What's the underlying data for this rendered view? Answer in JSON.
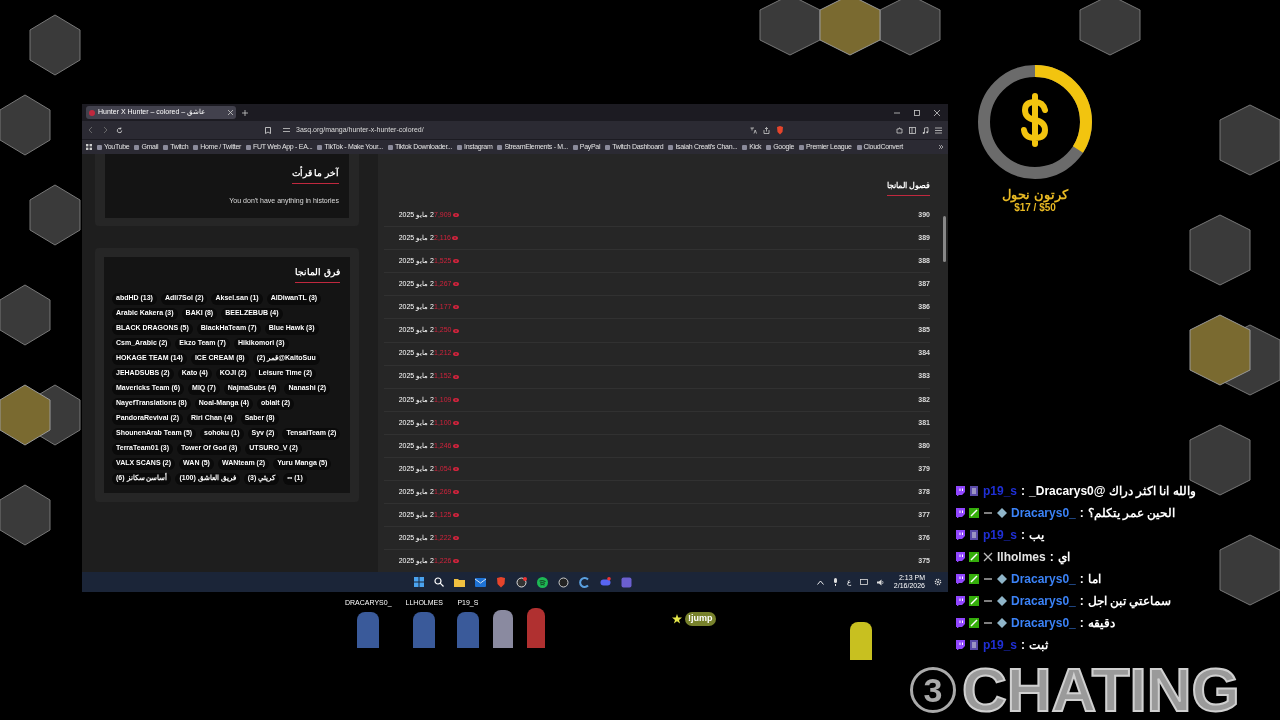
{
  "browser": {
    "tab_title": "Hunter X Hunter – colored – عاشق",
    "url": "3asq.org/manga/hunter-x-hunter-colored/",
    "bookmarks": [
      "YouTube",
      "Gmail",
      "Twitch",
      "Home / Twitter",
      "FUT Web App - EA...",
      "TikTok - Make Your...",
      "Tiktok Downloader...",
      "Instagram",
      "StreamElements - M...",
      "PayPal",
      "Twitch Dashboard",
      "Isaiah Creati's Chan...",
      "Kick",
      "Google",
      "Premier League",
      "CloudConvert"
    ]
  },
  "history_card": {
    "title": "آخر ما قرأت",
    "message": "You don't have anything in histories"
  },
  "teams_card": {
    "title": "فرق المانجا",
    "tags": [
      "abdHD (13)",
      "Adli7Sol (2)",
      "Aksel.san (1)",
      "AlDiwanTL (3)",
      "Arabic Kakera (3)",
      "BAKI (8)",
      "BEELZEBUB (4)",
      "BLACK DRAGONS (5)",
      "BlackHaTeam (7)",
      "Blue Hawk (3)",
      "Csm_Arabic (2)",
      "Ekzo Team (7)",
      "Hikikomori (3)",
      "HOKAGE TEAM (14)",
      "ICE CREAM (8)",
      "(2) قمر@KaitoSuu",
      "JEHADSUBS (2)",
      "Kato (4)",
      "KOJI (2)",
      "Leisure Time (2)",
      "Mavericks Team (6)",
      "MIQ (7)",
      "NajmaSubs (4)",
      "Nanashi (2)",
      "NayefTranslations (8)",
      "Noal-Manga (4)",
      "oblalt (2)",
      "PandoraRevival (2)",
      "Riri Chan (4)",
      "Saber (8)",
      "ShounenArab Team (5)",
      "sohoku (1)",
      "Syv (2)",
      "TensaiTeam (2)",
      "TerraTeam01 (3)",
      "Tower Of God (3)",
      "UTSURO_V (2)",
      "VALX SCANS (2)",
      "WAN (5)",
      "WANteam (2)",
      "Yuru Manga (5)",
      "أساسن سكانز (6)",
      "فريق العاشق (100)",
      "كريثي (3)",
      "∞ (1)"
    ]
  },
  "chapters": {
    "title": "فصول المانجا",
    "rows": [
      {
        "number": "390",
        "views": "7,909",
        "date": "2 مايو 2025"
      },
      {
        "number": "389",
        "views": "2,116",
        "date": "2 مايو 2025"
      },
      {
        "number": "388",
        "views": "1,525",
        "date": "2 مايو 2025"
      },
      {
        "number": "387",
        "views": "1,267",
        "date": "2 مايو 2025"
      },
      {
        "number": "386",
        "views": "1,177",
        "date": "2 مايو 2025"
      },
      {
        "number": "385",
        "views": "1,250",
        "date": "2 مايو 2025"
      },
      {
        "number": "384",
        "views": "1,212",
        "date": "2 مايو 2025"
      },
      {
        "number": "383",
        "views": "1,152",
        "date": "2 مايو 2025"
      },
      {
        "number": "382",
        "views": "1,109",
        "date": "2 مايو 2025"
      },
      {
        "number": "381",
        "views": "1,100",
        "date": "2 مايو 2025"
      },
      {
        "number": "380",
        "views": "1,246",
        "date": "2 مايو 2025"
      },
      {
        "number": "379",
        "views": "1,054",
        "date": "2 مايو 2025"
      },
      {
        "number": "378",
        "views": "1,269",
        "date": "2 مايو 2025"
      },
      {
        "number": "377",
        "views": "1,125",
        "date": "2 مايو 2025"
      },
      {
        "number": "376",
        "views": "1,222",
        "date": "2 مايو 2025"
      },
      {
        "number": "375",
        "views": "1,226",
        "date": "2 مايو 2025"
      }
    ]
  },
  "taskbar": {
    "language": "ع",
    "time": "2:13 PM",
    "date": "2/16/2026"
  },
  "goal": {
    "title": "كرتون نحول",
    "amount": "$17 / $50",
    "level": 0.34
  },
  "chat": [
    {
      "kind": "subscriber",
      "user": "p19_s",
      "color": "#1f2fd6",
      "separator": ":",
      "message": "والله انا اكثر دراك @Dracarys0_"
    },
    {
      "kind": "gem",
      "user": "Dracarys0_",
      "color": "#3b82f6",
      "separator": ":",
      "message": "الحين عمر يتكلم؟"
    },
    {
      "kind": "subscriber",
      "user": "p19_s",
      "color": "#1f2fd6",
      "separator": ":",
      "message": "يب"
    },
    {
      "kind": "blade",
      "user": "llholmes",
      "color": "#e5e5e5",
      "separator": ":",
      "message": "اي"
    },
    {
      "kind": "gem",
      "user": "Dracarys0_",
      "color": "#3b82f6",
      "separator": ":",
      "message": "اما"
    },
    {
      "kind": "gem",
      "user": "Dracarys0_",
      "color": "#3b82f6",
      "separator": ":",
      "message": "سماعتي تبن اجل"
    },
    {
      "kind": "gem",
      "user": "Dracarys0_",
      "color": "#3b82f6",
      "separator": ":",
      "message": "دقيقه"
    },
    {
      "kind": "subscriber",
      "user": "p19_s",
      "color": "#1f2fd6",
      "separator": ":",
      "message": "ثبت"
    }
  ],
  "stream_characters": [
    {
      "name": "DRACARYS0_"
    },
    {
      "name": "LLHOLMES"
    },
    {
      "name": "P19_S"
    }
  ],
  "jump_label": "!jump",
  "logo": {
    "badge": "3",
    "text": "CHATING"
  }
}
